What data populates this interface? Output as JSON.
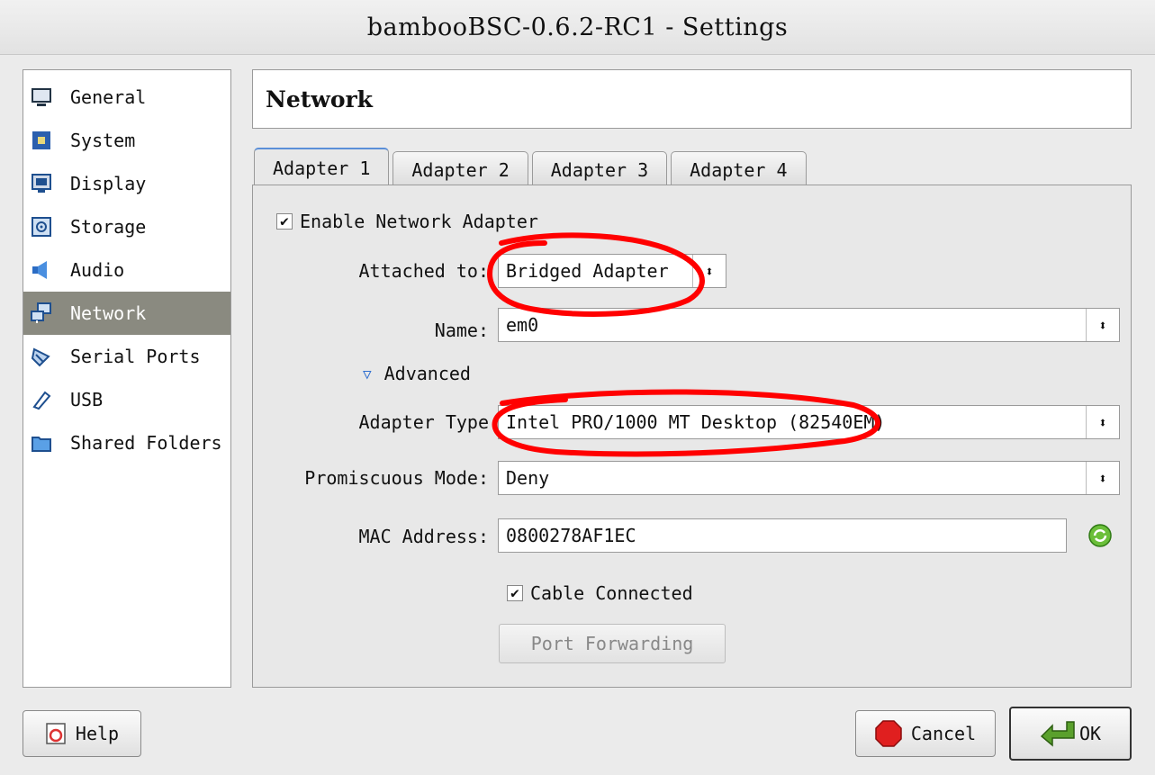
{
  "window": {
    "title": "bambooBSC-0.6.2-RC1 - Settings"
  },
  "sidebar": {
    "items": [
      {
        "label": "General",
        "icon": "monitor-icon"
      },
      {
        "label": "System",
        "icon": "chip-icon"
      },
      {
        "label": "Display",
        "icon": "display-icon"
      },
      {
        "label": "Storage",
        "icon": "disk-icon"
      },
      {
        "label": "Audio",
        "icon": "speaker-icon"
      },
      {
        "label": "Network",
        "icon": "network-icon",
        "selected": true
      },
      {
        "label": "Serial Ports",
        "icon": "serial-icon"
      },
      {
        "label": "USB",
        "icon": "usb-icon"
      },
      {
        "label": "Shared Folders",
        "icon": "folder-icon"
      }
    ]
  },
  "header": {
    "title": "Network"
  },
  "tabs": [
    {
      "label": "Adapter 1",
      "selected": true
    },
    {
      "label": "Adapter 2"
    },
    {
      "label": "Adapter 3"
    },
    {
      "label": "Adapter 4"
    }
  ],
  "adapter": {
    "enable_label": "Enable Network Adapter",
    "enable_checked": true,
    "attached_label": "Attached to:",
    "attached_value": "Bridged Adapter",
    "name_label": "Name:",
    "name_value": "em0",
    "advanced_label": "Advanced",
    "adapter_type_label": "Adapter Type",
    "adapter_type_value": "Intel PRO/1000 MT Desktop (82540EM)",
    "promiscuous_label": "Promiscuous Mode:",
    "promiscuous_value": "Deny",
    "mac_label": "MAC Address:",
    "mac_value": "0800278AF1EC",
    "cable_label": "Cable Connected",
    "cable_checked": true,
    "port_forwarding_label": "Port Forwarding"
  },
  "buttons": {
    "help": "Help",
    "cancel": "Cancel",
    "ok": "OK"
  },
  "colors": {
    "selection": "#8a8a80",
    "annotation": "#ff0000",
    "tab_accent": "#5b8fd8"
  }
}
